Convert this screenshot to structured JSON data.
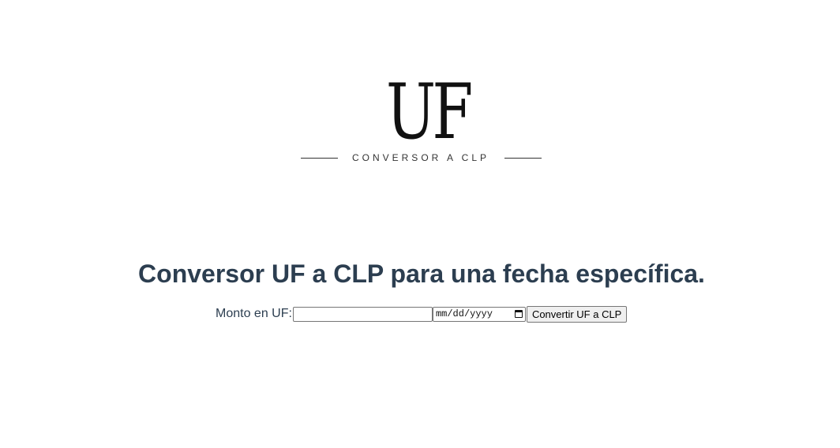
{
  "logo": {
    "mark": "UF",
    "subtitle": "CONVERSOR A CLP"
  },
  "main": {
    "title": "Conversor UF a CLP para una fecha específica.",
    "form": {
      "amount_label": "Monto en UF:",
      "amount_value": "",
      "date_placeholder": "mm/dd/yyyy",
      "convert_label": "Convertir UF a CLP"
    }
  },
  "icons": {
    "date_picker": "calendar-icon"
  },
  "colors": {
    "heading": "#2c3e50",
    "logo": "#111111"
  }
}
